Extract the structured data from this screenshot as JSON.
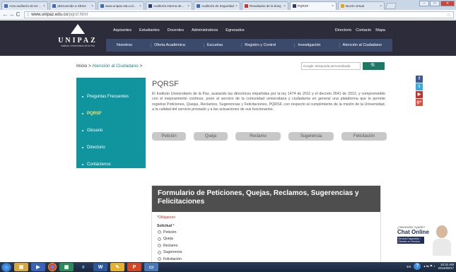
{
  "browser": {
    "tabs": [
      {
        "label": "Acta auditoría de tere..."
      },
      {
        "label": "¡Bienvenido a SENA"
      },
      {
        "label": "www.unipaz.edu.co/..."
      },
      {
        "label": "Auditoría Interna de..."
      },
      {
        "label": "Auditoría de Seguridad"
      },
      {
        "label": "Resultados de la búsq"
      },
      {
        "label": "PQRSF"
      },
      {
        "label": "Buzón virtual"
      }
    ],
    "active_tab_index": 6,
    "url_domain": "www.unipaz.edu.co",
    "url_path": "/pqrsf.html"
  },
  "header": {
    "logo_name": "UNIPAZ",
    "logo_subtitle": "Instituto Universitario de la Paz",
    "top_links": [
      "Aspirantes",
      "Estudiantes",
      "Docentes",
      "Administrativos",
      "Egresados"
    ],
    "utility_links": [
      "Directorio",
      "Contacto",
      "Mapa"
    ],
    "main_nav": [
      "Nosotros",
      "Oferta Académica",
      "Escuelas",
      "Registro y Control",
      "Investigación",
      "Atención al Ciudadano"
    ]
  },
  "breadcrumb": {
    "home": "Inicio",
    "separator": ">",
    "current": "Atención al Ciudadano",
    "trail_end": ">"
  },
  "search": {
    "placeholder": "Google: Búsqueda personalizada",
    "button_label": "🔍"
  },
  "sidebar": {
    "items": [
      {
        "label": "Preguntas Frecuentes",
        "active": false
      },
      {
        "label": "PQRSF",
        "active": true
      },
      {
        "label": "Glosario",
        "active": false
      },
      {
        "label": "Directorio",
        "active": false
      },
      {
        "label": "Contáctenos",
        "active": false
      }
    ]
  },
  "main": {
    "title": "PQRSF",
    "description": "El Instituto Universitario de la Paz, acatando las directrices impartidas por la ley 1474 de 2011 y el decreto 2641 de 2012, y comprometido con el mejoramiento continuo, pone al servicio de la comunidad universitaria y ciudadanía en general una plataforma que le permite registrar Peticiones, Quejas, Reclamos, Sugerencias y Felicitaciones, PQRSF, con respecto al cumplimiento de la misión de la Universidad, a la calidad del servicio prestado y a las actuaciones de sus funcionarios.",
    "choices": [
      "Petición",
      "Queja",
      "Reclamo",
      "Sugerencia",
      "Felicitación"
    ]
  },
  "social": [
    "f",
    "t",
    "▶",
    "g+"
  ],
  "form": {
    "title": "Formulario de Peticiones, Quejas, Reclamos, Sugerencias y Felicitaciones",
    "required_note": "*Obligatorio",
    "field_label": "Solicitud",
    "field_required_mark": "*",
    "options": [
      "Petición",
      "Queja",
      "Reclamo",
      "Sugerencia",
      "Felicitación"
    ]
  },
  "chat": {
    "question": "¿Necesitas Ayuda?",
    "title": "Chat Online",
    "subtitle": "Servicio Disponible / Clientes en Servicio"
  },
  "taskbar": {
    "lang": "ES",
    "time": "10:31 AM",
    "date": "2015/09/17"
  }
}
